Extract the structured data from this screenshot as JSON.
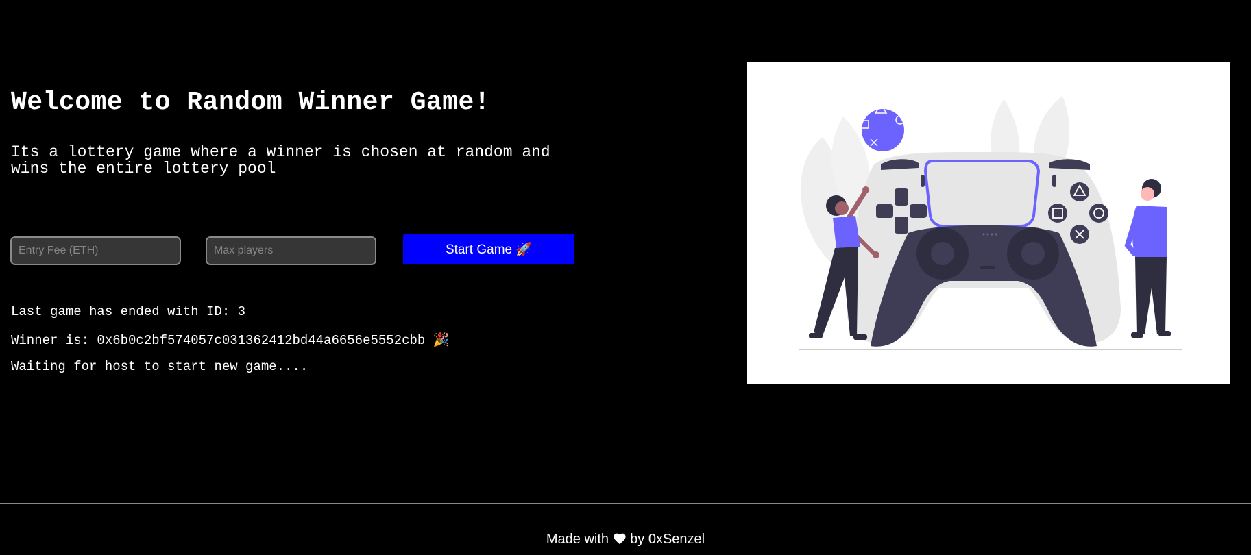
{
  "header": {
    "title": "Welcome to Random Winner Game!"
  },
  "intro": {
    "description": "Its a lottery game where a winner is chosen at random and wins the entire lottery pool"
  },
  "form": {
    "entry_fee_placeholder": "Entry Fee (ETH)",
    "max_players_placeholder": "Max players",
    "start_label": "Start Game 🚀"
  },
  "status": {
    "last_game": "Last game has ended with ID: 3",
    "winner": "Winner is: 0x6b0c2bf574057c031362412bd44a6656e5552cbb 🎉",
    "waiting": "Waiting for host to start new game...."
  },
  "footer": {
    "made_with": "Made with",
    "by": "by 0xSenzel"
  },
  "icons": {
    "start_button": "rocket-icon",
    "winner": "party-popper-icon",
    "footer_heart": "heart-icon",
    "illustration": "game-controller-illustration"
  },
  "colors": {
    "button": "#0000ff",
    "accent": "#6c63ff",
    "background": "#000000"
  }
}
